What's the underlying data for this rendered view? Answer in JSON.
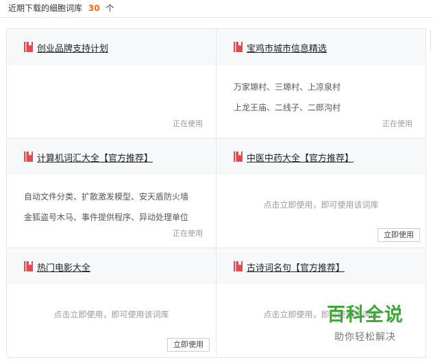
{
  "header": {
    "prefix": "近期下载的细胞词库",
    "count": "30",
    "suffix": "个"
  },
  "cards": [
    {
      "title": "创业品牌支持计划",
      "samples": [],
      "status": "正在使用",
      "hint": "",
      "button": ""
    },
    {
      "title": "宝鸡市城市信息精选",
      "samples": [
        "万家塬村、三塬村、上凉泉村",
        "上龙王庙、二线子、二郎沟村"
      ],
      "status": "正在使用",
      "hint": "",
      "button": ""
    },
    {
      "title": "计算机词汇大全【官方推荐】",
      "samples": [
        "自动文件分类、扩散激发模型、安天盾防火墙",
        "金狐盗号木马、事件提供程序、异动处理单位"
      ],
      "status": "正在使用",
      "hint": "",
      "button": ""
    },
    {
      "title": "中医中药大全【官方推荐】",
      "samples": [],
      "status": "",
      "hint": "点击立即使用，即可使用该词库",
      "button": "立即使用"
    },
    {
      "title": "热门电影大全",
      "samples": [],
      "status": "",
      "hint": "点击立即使用，即可使用该词库",
      "button": "立即使用"
    },
    {
      "title": "古诗词名句【官方推荐】",
      "samples": [],
      "status": "",
      "hint": "点击立即使用，即可使用该词库",
      "button": ""
    }
  ],
  "watermark": {
    "main": "百科全说",
    "sub": "助你轻松解决"
  },
  "colors": {
    "accent": "#ff6600",
    "icon": "#e8474f",
    "watermark": "#3aa832"
  }
}
